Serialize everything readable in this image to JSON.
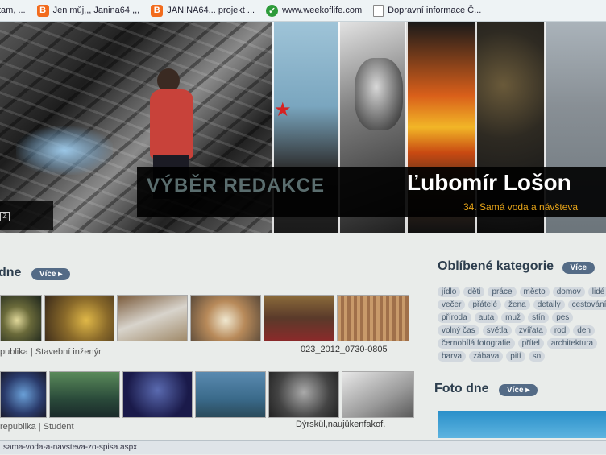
{
  "bookmarks": [
    {
      "label": "tam, ...",
      "icon": "none"
    },
    {
      "label": "Jen můj,,, Janina64 ,,,",
      "icon": "blogger-icon"
    },
    {
      "label": "JANINA64... projekt ...",
      "icon": "blogger-icon"
    },
    {
      "label": "www.weekoflife.com",
      "icon": "weekoflife-icon"
    },
    {
      "label": "Dopravní informace Č...",
      "icon": "document-icon"
    }
  ],
  "banner": {
    "section_title": "VÝBĚR REDAKCE",
    "author": "Ľubomír Lošon",
    "subtitle": "34. Samá voda a návšteva",
    "button_glyph": "Z"
  },
  "left_section": {
    "title_fragment": "dne",
    "more_label": "Více",
    "rows": [
      {
        "meta": "publika | Stavební inženýr",
        "caption": "023_2012_0730-0805",
        "thumbs": [
          "#2c3b2c",
          "#c9a24a",
          "#8a6a3a",
          "#d8c7a0",
          "#7a5a3a",
          "#c7a07a"
        ]
      },
      {
        "meta": "republika | Student",
        "caption": "Dýrskül,naujûkenfakof.",
        "thumbs": [
          "#3a5a8a",
          "#4a7a5a",
          "#1e2a5a",
          "#4a7aa0",
          "#555555",
          "#bfbfbf"
        ]
      }
    ]
  },
  "categories": {
    "title": "Oblíbené kategorie",
    "more_label": "Více",
    "tags": [
      "jídlo",
      "děti",
      "práce",
      "město",
      "domov",
      "lidé",
      "večer",
      "přátelé",
      "žena",
      "detaily",
      "cestování",
      "příroda",
      "auta",
      "muž",
      "stín",
      "pes",
      "volný čas",
      "světla",
      "zvířata",
      "rod",
      "den",
      "černobílá fotografie",
      "přítel",
      "architektura",
      "barva",
      "zábava",
      "pití",
      "sn"
    ]
  },
  "foto_dne": {
    "title": "Foto dne",
    "more_label": "Více"
  },
  "status": {
    "url": "sama-voda-a-navsteva-zo-spisa.aspx"
  }
}
